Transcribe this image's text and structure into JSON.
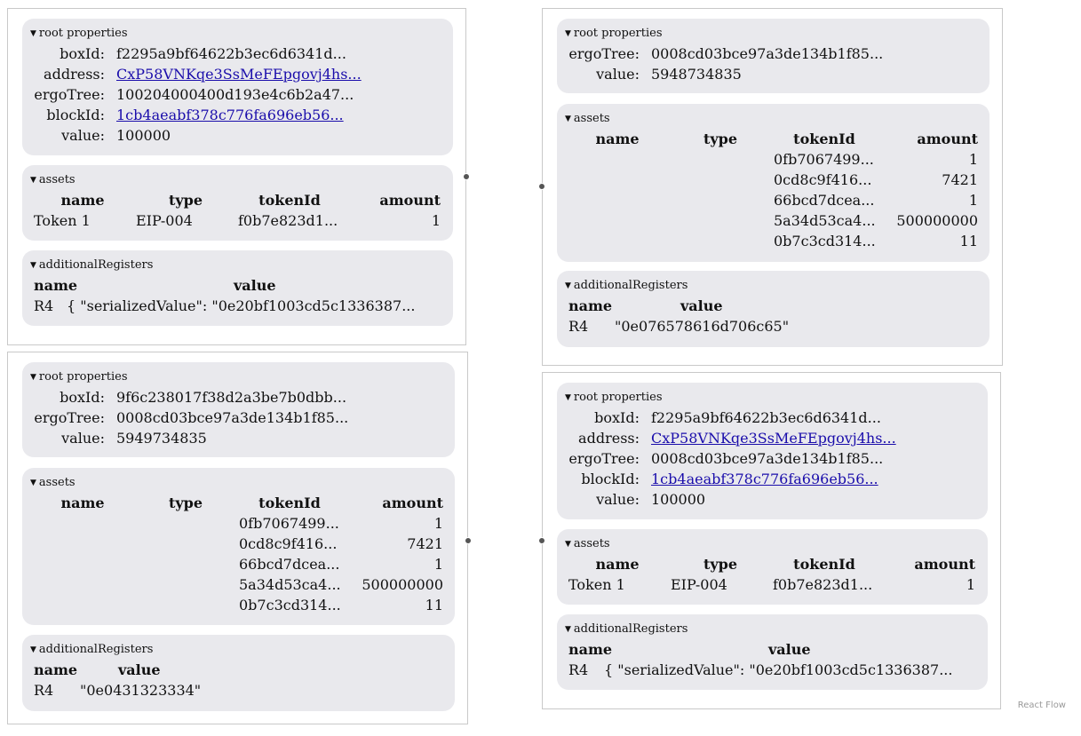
{
  "flow": {
    "attribution": "React Flow"
  },
  "nodeA": {
    "root": {
      "title": "root properties",
      "boxId_label": "boxId:",
      "boxId": "f2295a9bf64622b3ec6d6341d...",
      "address_label": "address:",
      "address": "CxP58VNKqe3SsMeFEpgovj4hs...",
      "ergoTree_label": "ergoTree:",
      "ergoTree": "100204000400d193e4c6b2a47...",
      "blockId_label": "blockId:",
      "blockId": "1cb4aeabf378c776fa696eb56...",
      "value_label": "value:",
      "value": "100000"
    },
    "assets": {
      "title": "assets",
      "headers": [
        "name",
        "type",
        "tokenId",
        "amount"
      ],
      "rows": [
        [
          "Token 1",
          "EIP-004",
          "f0b7e823d1...",
          "1"
        ]
      ]
    },
    "registers": {
      "title": "additionalRegisters",
      "headers": [
        "name",
        "value"
      ],
      "rows": [
        [
          "R4",
          "{ \"serializedValue\": \"0e20bf1003cd5c1336387..."
        ]
      ]
    }
  },
  "nodeB": {
    "root": {
      "title": "root properties",
      "boxId_label": "boxId:",
      "boxId": "9f6c238017f38d2a3be7b0dbb...",
      "ergoTree_label": "ergoTree:",
      "ergoTree": "0008cd03bce97a3de134b1f85...",
      "value_label": "value:",
      "value": "5949734835"
    },
    "assets": {
      "title": "assets",
      "headers": [
        "name",
        "type",
        "tokenId",
        "amount"
      ],
      "rows": [
        [
          "",
          "",
          "0fb7067499...",
          "1"
        ],
        [
          "",
          "",
          "0cd8c9f416...",
          "7421"
        ],
        [
          "",
          "",
          "66bcd7dcea...",
          "1"
        ],
        [
          "",
          "",
          "5a34d53ca4...",
          "500000000"
        ],
        [
          "",
          "",
          "0b7c3cd314...",
          "11"
        ]
      ]
    },
    "registers": {
      "title": "additionalRegisters",
      "headers": [
        "name",
        "value"
      ],
      "rows": [
        [
          "R4",
          "\"0e0431323334\""
        ]
      ]
    }
  },
  "nodeC": {
    "root": {
      "title": "root properties",
      "ergoTree_label": "ergoTree:",
      "ergoTree": "0008cd03bce97a3de134b1f85...",
      "value_label": "value:",
      "value": "5948734835"
    },
    "assets": {
      "title": "assets",
      "headers": [
        "name",
        "type",
        "tokenId",
        "amount"
      ],
      "rows": [
        [
          "",
          "",
          "0fb7067499...",
          "1"
        ],
        [
          "",
          "",
          "0cd8c9f416...",
          "7421"
        ],
        [
          "",
          "",
          "66bcd7dcea...",
          "1"
        ],
        [
          "",
          "",
          "5a34d53ca4...",
          "500000000"
        ],
        [
          "",
          "",
          "0b7c3cd314...",
          "11"
        ]
      ]
    },
    "registers": {
      "title": "additionalRegisters",
      "headers": [
        "name",
        "value"
      ],
      "rows": [
        [
          "R4",
          "\"0e076578616d706c65\""
        ]
      ]
    }
  },
  "nodeD": {
    "root": {
      "title": "root properties",
      "boxId_label": "boxId:",
      "boxId": "f2295a9bf64622b3ec6d6341d...",
      "address_label": "address:",
      "address": "CxP58VNKqe3SsMeFEpgovj4hs...",
      "ergoTree_label": "ergoTree:",
      "ergoTree": "0008cd03bce97a3de134b1f85...",
      "blockId_label": "blockId:",
      "blockId": "1cb4aeabf378c776fa696eb56...",
      "value_label": "value:",
      "value": "100000"
    },
    "assets": {
      "title": "assets",
      "headers": [
        "name",
        "type",
        "tokenId",
        "amount"
      ],
      "rows": [
        [
          "Token 1",
          "EIP-004",
          "f0b7e823d1...",
          "1"
        ]
      ]
    },
    "registers": {
      "title": "additionalRegisters",
      "headers": [
        "name",
        "value"
      ],
      "rows": [
        [
          "R4",
          "{ \"serializedValue\": \"0e20bf1003cd5c1336387..."
        ]
      ]
    }
  }
}
